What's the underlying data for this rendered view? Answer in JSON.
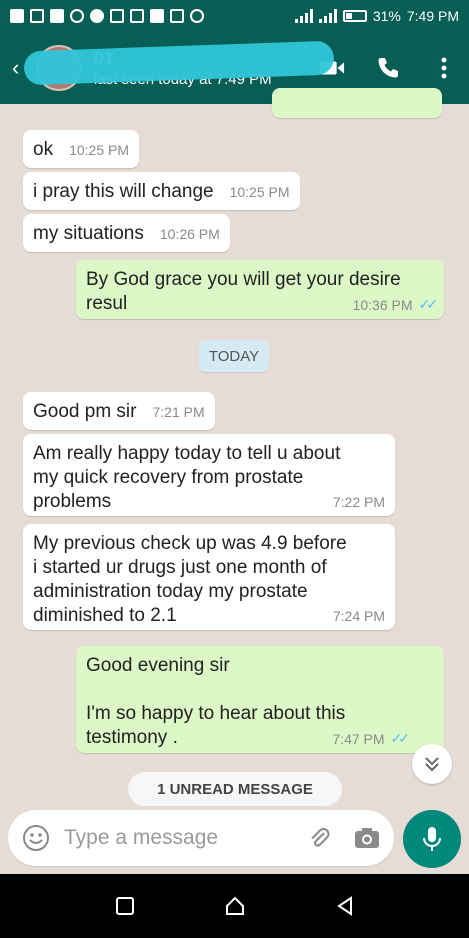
{
  "status_bar": {
    "battery": "31%",
    "time": "7:49 PM"
  },
  "header": {
    "contact_name": "01",
    "last_seen": "last seen today at 7:49 PM",
    "icons": [
      "back-arrow-icon",
      "video-call-icon",
      "voice-call-icon",
      "more-options-icon"
    ]
  },
  "messages": [
    {
      "dir": "in",
      "text": "ok",
      "time": "10:25 PM"
    },
    {
      "dir": "in",
      "text": "i pray this will change",
      "time": "10:25 PM"
    },
    {
      "dir": "in",
      "text": "my situations",
      "time": "10:26 PM"
    },
    {
      "dir": "out",
      "text": "By God grace you will get your desire\nresul",
      "time": "10:36 PM"
    },
    {
      "dir": "in",
      "text": "Good pm sir",
      "time": "7:21 PM"
    },
    {
      "dir": "in",
      "text": "Am really happy today to tell u about\nmy quick recovery from prostate\nproblems",
      "time": "7:22 PM"
    },
    {
      "dir": "in",
      "text": "My previous check up was 4.9 before\ni started ur drugs just one month of\nadministration today my prostate\ndiminished to 2.1",
      "time": "7:24 PM"
    },
    {
      "dir": "out",
      "text": "Good evening sir\n\nI'm so happy to hear about this\ntestimony .",
      "time": "7:47 PM"
    }
  ],
  "date_chip": "TODAY",
  "unread_label": "1 UNREAD MESSAGE",
  "composer": {
    "placeholder": "Type a message"
  },
  "colors": {
    "header": "#075e54",
    "outgoing": "#dcf8c6",
    "incoming": "#ffffff",
    "accent": "#00897b",
    "ticks": "#4fc3f7"
  }
}
